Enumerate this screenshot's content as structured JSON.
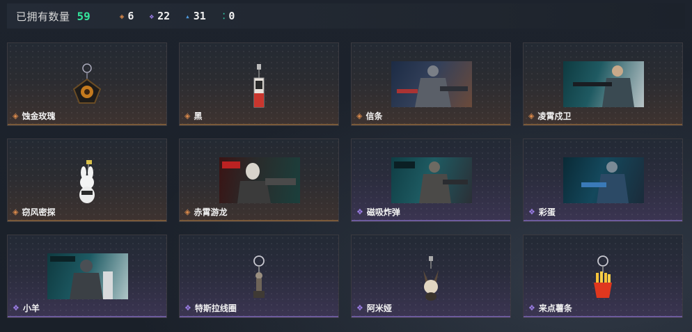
{
  "header": {
    "owned_label": "已拥有数量",
    "owned_count": "59",
    "stats": [
      {
        "icon": "diamond-icon",
        "color": "#d9894a",
        "value": "6"
      },
      {
        "icon": "diamond-icon",
        "color": "#9b7de6",
        "value": "22"
      },
      {
        "icon": "diamond-icon",
        "color": "#4e9be0",
        "value": "31"
      },
      {
        "icon": "diamond-icon",
        "color": "#2fcfa8",
        "value": "0"
      }
    ]
  },
  "items": [
    {
      "name": "蚀金玫瑰",
      "rarity": "orange",
      "kind": "charm"
    },
    {
      "name": "黑",
      "rarity": "orange",
      "kind": "charm"
    },
    {
      "name": "信条",
      "rarity": "orange",
      "kind": "image"
    },
    {
      "name": "凌霄戍卫",
      "rarity": "orange",
      "kind": "image"
    },
    {
      "name": "窃风密探",
      "rarity": "orange",
      "kind": "charm"
    },
    {
      "name": "赤霄游龙",
      "rarity": "orange",
      "kind": "image"
    },
    {
      "name": "磁吸炸弹",
      "rarity": "purple",
      "kind": "image"
    },
    {
      "name": "彩蛋",
      "rarity": "purple",
      "kind": "image"
    },
    {
      "name": "小羊",
      "rarity": "purple",
      "kind": "image"
    },
    {
      "name": "特斯拉线圈",
      "rarity": "purple",
      "kind": "charm"
    },
    {
      "name": "阿米娅",
      "rarity": "purple",
      "kind": "charm"
    },
    {
      "name": "来点薯条",
      "rarity": "purple",
      "kind": "charm"
    }
  ]
}
